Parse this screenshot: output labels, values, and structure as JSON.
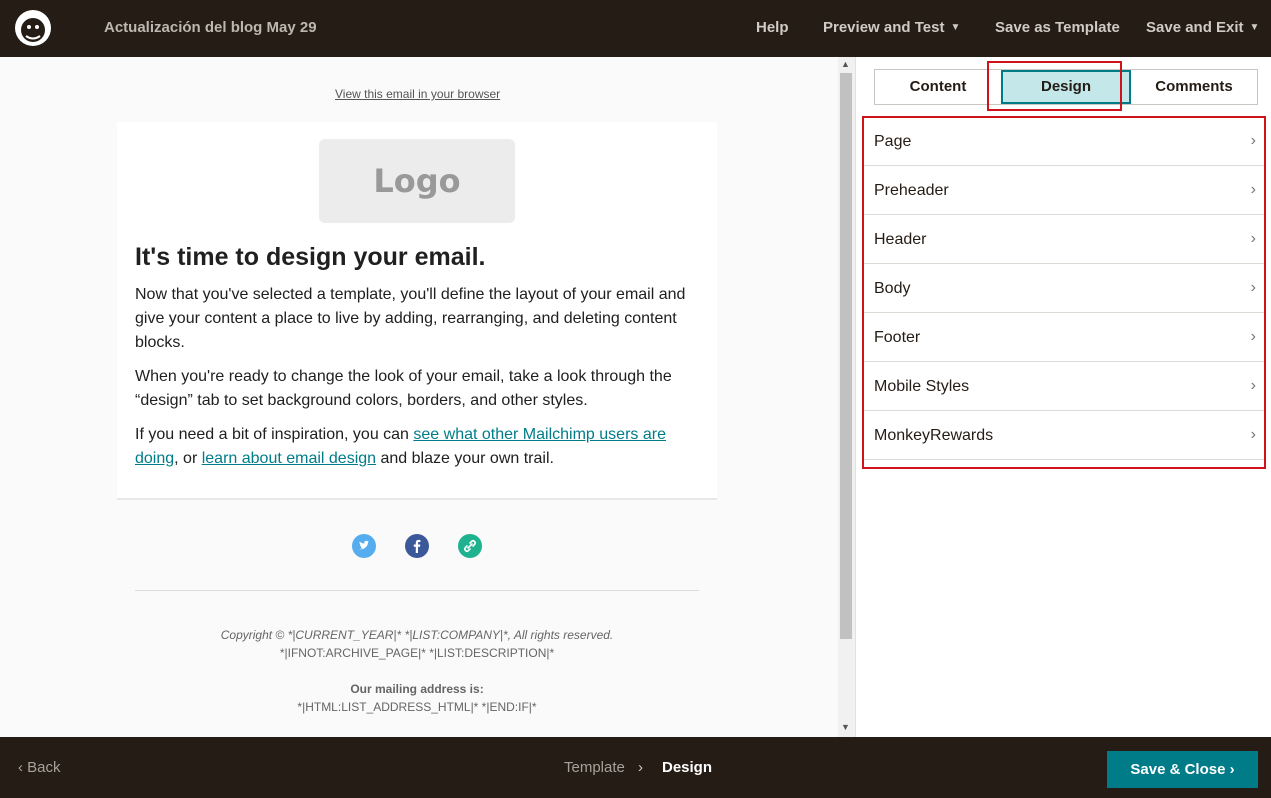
{
  "topbar": {
    "campaign_title": "Actualización del blog May 29",
    "help": "Help",
    "preview_and_test": "Preview and Test",
    "save_as_template": "Save as Template",
    "save_and_exit": "Save and Exit"
  },
  "preview": {
    "view_in_browser": "View this email in your browser",
    "logo_placeholder": "Logo",
    "heading": "It's time to design your email.",
    "para1": "Now that you've selected a template, you'll define the layout of your email and give your content a place to live by adding, rearranging, and deleting content blocks.",
    "para2": "When you're ready to change the look of your email, take a look through the “design” tab to set background colors, borders, and other styles.",
    "para3_before": "If you need a bit of inspiration, you can ",
    "para3_link1": "see what other Mailchimp users are doing",
    "para3_middle": ", or ",
    "para3_link2": "learn about email design",
    "para3_after": " and blaze your own trail.",
    "footer_copyright": "Copyright © *|CURRENT_YEAR|* *|LIST:COMPANY|*, All rights reserved.",
    "footer_desc": "*|IFNOT:ARCHIVE_PAGE|* *|LIST:DESCRIPTION|*",
    "footer_address_label": "Our mailing address is:",
    "footer_address": "*|HTML:LIST_ADDRESS_HTML|* *|END:IF|*"
  },
  "social": [
    {
      "name": "twitter-icon",
      "color": "#55acee"
    },
    {
      "name": "facebook-icon",
      "color": "#3b5998"
    },
    {
      "name": "link-icon",
      "color": "#1fb28e"
    }
  ],
  "right_panel": {
    "tabs": [
      {
        "label": "Content",
        "active": false
      },
      {
        "label": "Design",
        "active": true
      },
      {
        "label": "Comments",
        "active": false
      }
    ],
    "design_items": [
      "Page",
      "Preheader",
      "Header",
      "Body",
      "Footer",
      "Mobile Styles",
      "MonkeyRewards"
    ]
  },
  "bottombar": {
    "back": "Back",
    "crumb_template": "Template",
    "crumb_design": "Design",
    "save_close": "Save & Close"
  },
  "colors": {
    "topbar_bg": "#241c15",
    "accent_teal": "#007c89",
    "active_tab_bg": "#c4e7ea",
    "highlight_red": "#d0131a"
  }
}
